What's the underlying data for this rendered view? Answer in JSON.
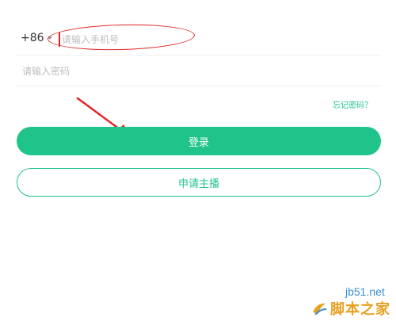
{
  "login_form": {
    "country_code": "+86",
    "phone_placeholder": "请输入手机号",
    "phone_value": "",
    "password_placeholder": "请输入密码",
    "password_value": "",
    "forgot_password": "忘记密码？",
    "login_button": "登录",
    "apply_host_button": "申请主播"
  },
  "icons": {
    "country_dropdown": "caret-down-icon"
  },
  "colors": {
    "accent": "#1ec48a",
    "annotation": "#e02626",
    "watermark_blue": "#3a8fd0",
    "watermark_orange": "#e8a020"
  },
  "watermark": {
    "site": "jb51.net",
    "name": "脚本之家"
  }
}
